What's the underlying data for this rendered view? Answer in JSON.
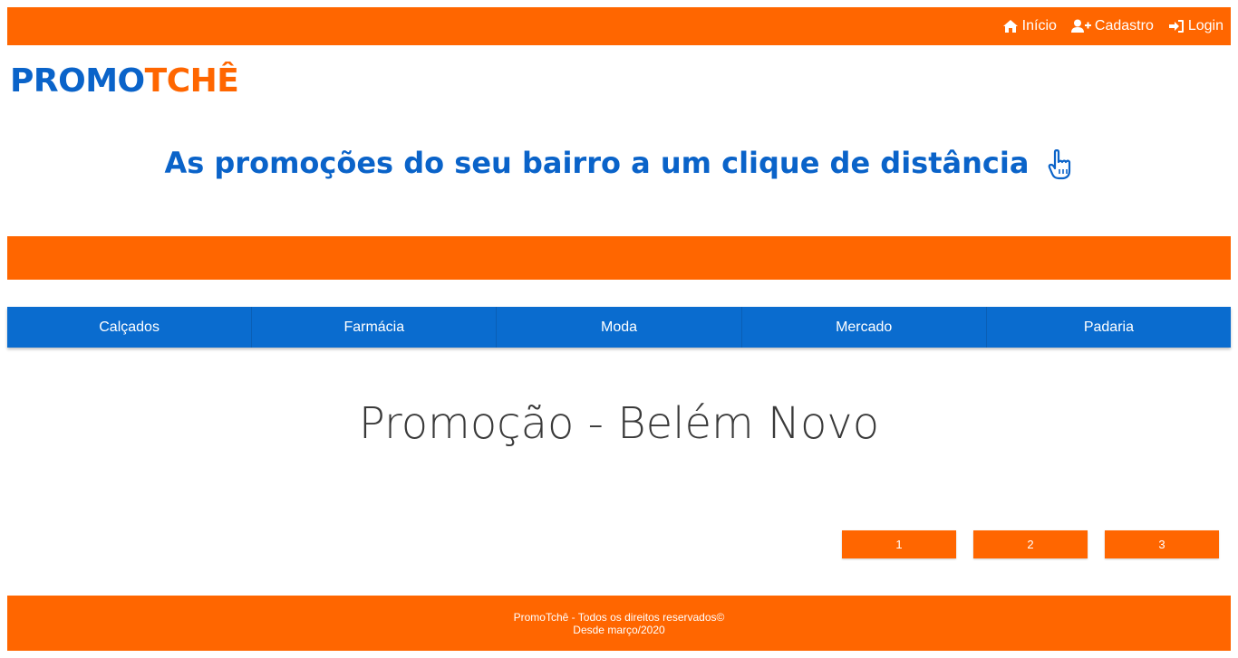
{
  "nav": {
    "home_label": "Início",
    "register_label": "Cadastro",
    "login_label": "Login"
  },
  "logo": {
    "part1": "PROMO",
    "part2": "TCHÊ"
  },
  "tagline": "As promoções do seu bairro a um clique de distância",
  "categories": [
    "Calçados",
    "Farmácia",
    "Moda",
    "Mercado",
    "Padaria"
  ],
  "main": {
    "heading": "Promoção - Belém Novo"
  },
  "pagination": [
    "1",
    "2",
    "3"
  ],
  "footer": {
    "line1": "PromoTchê - Todos os direitos reservados©",
    "line2": "Desde março/2020"
  },
  "colors": {
    "orange": "#ff6600",
    "blue": "#0a63c9",
    "category_bar": "#0a6ccf"
  },
  "icons": {
    "home": "home-icon",
    "register": "user-plus-icon",
    "login": "sign-in-icon",
    "tagline": "pointing-hand-icon"
  }
}
